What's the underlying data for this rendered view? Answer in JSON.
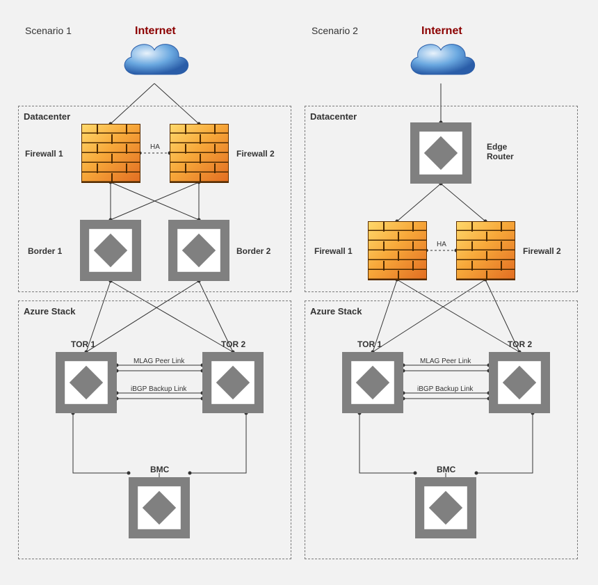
{
  "scenario1": {
    "title": "Scenario 1",
    "internet_label": "Internet",
    "datacenter_label": "Datacenter",
    "firewall1_label": "Firewall 1",
    "firewall2_label": "Firewall 2",
    "ha_label": "HA",
    "border1_label": "Border 1",
    "border2_label": "Border 2",
    "azure_stack_label": "Azure Stack",
    "tor1_label": "TOR 1",
    "tor2_label": "TOR 2",
    "mlag_label": "MLAG Peer Link",
    "ibgp_label": "iBGP Backup Link",
    "bmc_label": "BMC"
  },
  "scenario2": {
    "title": "Scenario 2",
    "internet_label": "Internet",
    "datacenter_label": "Datacenter",
    "edge_router_label": "Edge\nRouter",
    "firewall1_label": "Firewall 1",
    "firewall2_label": "Firewall 2",
    "ha_label": "HA",
    "azure_stack_label": "Azure Stack",
    "tor1_label": "TOR 1",
    "tor2_label": "TOR 2",
    "mlag_label": "MLAG Peer Link",
    "ibgp_label": "iBGP Backup Link",
    "bmc_label": "BMC"
  }
}
